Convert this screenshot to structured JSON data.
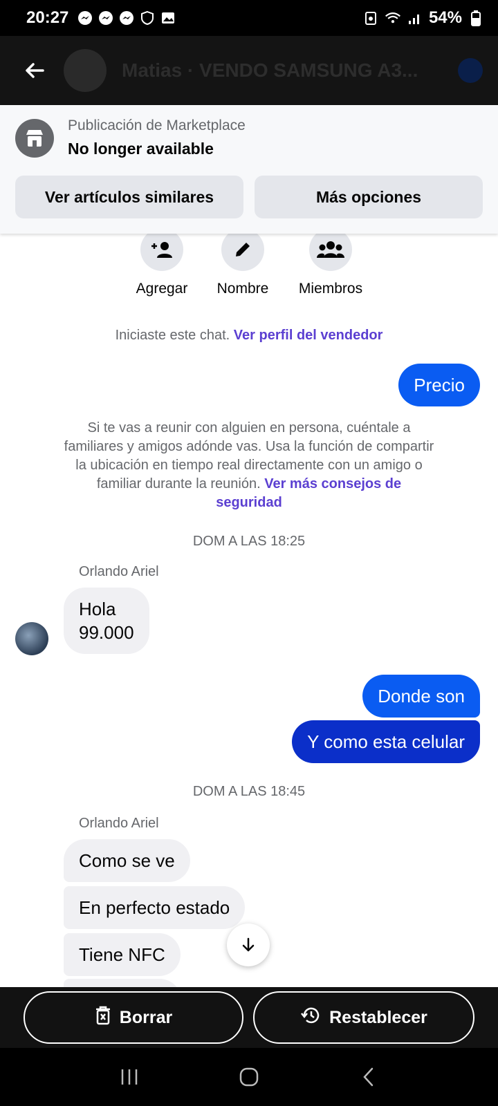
{
  "status_bar": {
    "time": "20:27",
    "battery": "54%"
  },
  "header": {
    "title": "Matias · VENDO SAMSUNG A3..."
  },
  "marketplace": {
    "subtitle": "Publicación de Marketplace",
    "status": "No longer available",
    "similar_button": "Ver artículos similares",
    "options_button": "Más opciones"
  },
  "actions": [
    {
      "label": "Agregar",
      "icon": "add-person-icon"
    },
    {
      "label": "Nombre",
      "icon": "pencil-icon"
    },
    {
      "label": "Miembros",
      "icon": "group-icon"
    }
  ],
  "chat": {
    "started_text": "Iniciaste este chat.",
    "seller_link": "Ver perfil del vendedor",
    "safety_text": "Si te vas a reunir con alguien en persona, cuéntale a familiares y amigos adónde vas. Usa la función de compartir la ubicación en tiempo real directamente con un amigo o familiar durante la reunión.",
    "safety_link": "Ver más consejos de seguridad",
    "timestamp_1": "DOM A LAS 18:25",
    "timestamp_2": "DOM A LAS 18:45",
    "contact_name": "Orlando Ariel",
    "messages": {
      "m1": "Precio",
      "m2_line1": "Hola",
      "m2_line2": "99.000",
      "m3": "Donde son",
      "m4": "Y como esta celular",
      "m5": "Como se ve",
      "m6": "En perfecto estado",
      "m7": "Tiene NFC"
    }
  },
  "bottom": {
    "delete_label": "Borrar",
    "restore_label": "Restablecer"
  },
  "colors": {
    "accent": "#0a5cf2",
    "link": "#5b3fd1"
  }
}
